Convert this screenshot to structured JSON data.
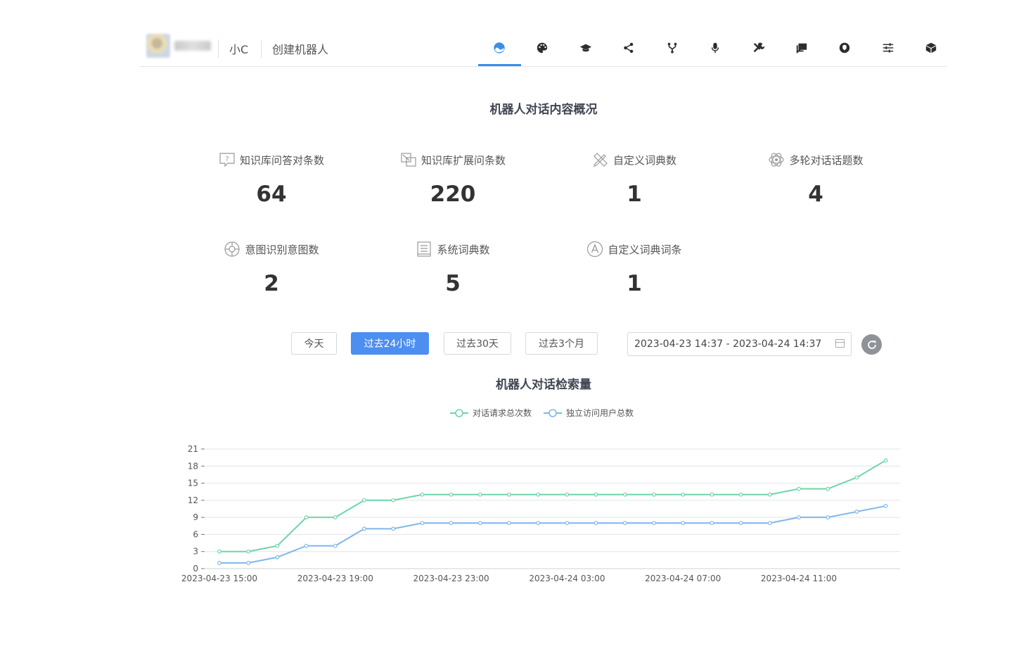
{
  "header": {
    "breadcrumb": [
      "小C",
      "创建机器人"
    ],
    "nav_icons": [
      "dashboard-icon",
      "palette-icon",
      "graduation-cap-icon",
      "share-icon",
      "fork-icon",
      "microphone-icon",
      "tools-icon",
      "chat-icon",
      "plugin-icon",
      "sliders-icon",
      "cube-icon"
    ],
    "active_index": 0,
    "accent_color": "#3a8ee6"
  },
  "overview": {
    "title": "机器人对话内容概况",
    "stats": [
      {
        "label": "知识库问答对条数",
        "value": "64",
        "icon": "question-box-icon"
      },
      {
        "label": "知识库扩展问条数",
        "value": "220",
        "icon": "copy-squares-icon"
      },
      {
        "label": "自定义词典数",
        "value": "1",
        "icon": "pencil-ruler-icon"
      },
      {
        "label": "多轮对话话题数",
        "value": "4",
        "icon": "atom-dialog-icon"
      },
      {
        "label": "意图识别意图数",
        "value": "2",
        "icon": "target-icon"
      },
      {
        "label": "系统词典数",
        "value": "5",
        "icon": "book-icon"
      },
      {
        "label": "自定义词典词条",
        "value": "1",
        "icon": "letter-a-circle-icon"
      }
    ]
  },
  "filters": {
    "buttons": [
      "今天",
      "过去24小时",
      "过去30天",
      "过去3个月"
    ],
    "active": 1,
    "date_range": "2023-04-23 14:37 - 2023-04-24 14:37"
  },
  "chart_title": "机器人对话检索量",
  "chart_data": {
    "type": "line",
    "x": [
      "2023-04-23 15:00",
      "2023-04-23 16:00",
      "2023-04-23 17:00",
      "2023-04-23 18:00",
      "2023-04-23 19:00",
      "2023-04-23 20:00",
      "2023-04-23 21:00",
      "2023-04-23 22:00",
      "2023-04-23 23:00",
      "2023-04-24 00:00",
      "2023-04-24 01:00",
      "2023-04-24 02:00",
      "2023-04-24 03:00",
      "2023-04-24 04:00",
      "2023-04-24 05:00",
      "2023-04-24 06:00",
      "2023-04-24 07:00",
      "2023-04-24 08:00",
      "2023-04-24 09:00",
      "2023-04-24 10:00",
      "2023-04-24 11:00",
      "2023-04-24 12:00",
      "2023-04-24 13:00",
      "2023-04-24 14:00"
    ],
    "xticks": [
      "2023-04-23 15:00",
      "2023-04-23 19:00",
      "2023-04-23 23:00",
      "2023-04-24 03:00",
      "2023-04-24 07:00",
      "2023-04-24 11:00"
    ],
    "series": [
      {
        "name": "对话请求总次数",
        "color": "#6fd5a8",
        "values": [
          3,
          3,
          4,
          9,
          9,
          12,
          12,
          13,
          13,
          13,
          13,
          13,
          13,
          13,
          13,
          13,
          13,
          13,
          13,
          13,
          14,
          14,
          16,
          19
        ]
      },
      {
        "name": "独立访问用户总数",
        "color": "#7fb6ea",
        "values": [
          1,
          1,
          2,
          4,
          4,
          7,
          7,
          8,
          8,
          8,
          8,
          8,
          8,
          8,
          8,
          8,
          8,
          8,
          8,
          8,
          9,
          9,
          10,
          11
        ]
      }
    ],
    "ylim": [
      0,
      21
    ],
    "yticks": [
      0,
      3,
      6,
      9,
      12,
      15,
      18,
      21
    ],
    "legend": "top-center",
    "grid": true
  }
}
